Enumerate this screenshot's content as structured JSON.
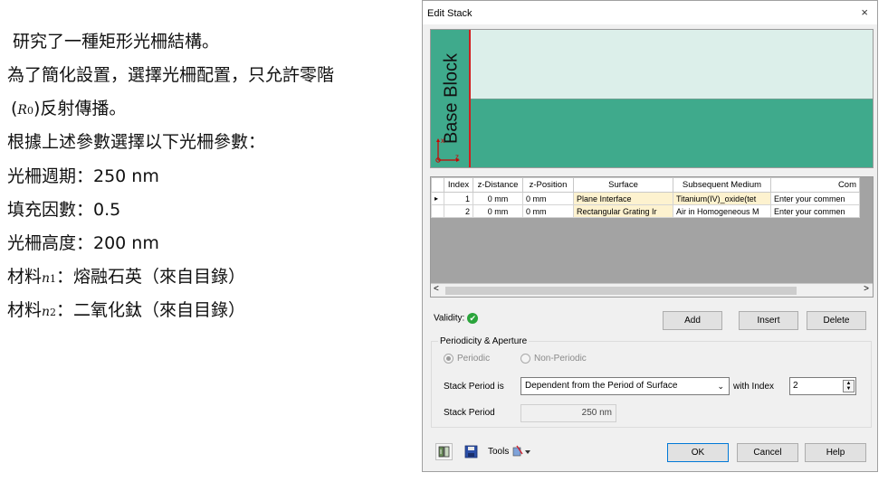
{
  "description": {
    "line1": "研究了一種矩形光柵結構。",
    "line2": "為了簡化設置，選擇光柵配置，只允許零階",
    "line3_pre": "(",
    "line3_sym": "R",
    "line3_sub": "0",
    "line3_post": ")反射傳播。",
    "line4": "根據上述參數選擇以下光柵參數：",
    "line5": "光柵週期：250 nm",
    "line6": "填充因數：0.5",
    "line7": "光柵高度：200 nm",
    "line8_pre": "材料",
    "line8_sym": "n",
    "line8_sub": "1",
    "line8_post": "：熔融石英（來自目錄）",
    "line9_pre": "材料",
    "line9_sym": "n",
    "line9_sub": "2",
    "line9_post": "：二氧化鈦（來自目錄）"
  },
  "dialog": {
    "title": "Edit Stack",
    "close": "×",
    "preview": {
      "base_block_label": "Base Block",
      "axis_x": "x",
      "axis_z": "z",
      "colors": {
        "air": "#dcefea",
        "titanium": "#3faa8c",
        "base": "#3faa8c",
        "marker": "#d21f1f"
      }
    },
    "table": {
      "columns": [
        "Index",
        "z-Distance",
        "z-Position",
        "Surface",
        "Subsequent Medium",
        "Com"
      ],
      "rows": [
        {
          "marker": "▸",
          "index": "1",
          "z_distance": "0 mm",
          "z_position": "0 mm",
          "surface": "Plane Interface",
          "medium": "Titanium(IV)_oxide(tet",
          "comment": "Enter your commen"
        },
        {
          "marker": "",
          "index": "2",
          "z_distance": "0 mm",
          "z_position": "0 mm",
          "surface": "Rectangular Grating Ir",
          "medium": "Air in Homogeneous M",
          "comment": "Enter your commen"
        }
      ],
      "scroll_left": "<",
      "scroll_right": ">"
    },
    "validity_label": "Validity:",
    "validity_icon": "✔",
    "buttons": {
      "add": "Add",
      "insert": "Insert",
      "delete": "Delete",
      "ok": "OK",
      "cancel": "Cancel",
      "help": "Help",
      "tools": "Tools"
    },
    "periodicity": {
      "group_title": "Periodicity & Aperture",
      "periodic": "Periodic",
      "non_periodic": "Non-Periodic",
      "stack_period_is_label": "Stack Period is",
      "stack_period_is_value": "Dependent from the Period of Surface",
      "with_index_label": "with Index",
      "with_index_value": "2",
      "stack_period_label": "Stack Period",
      "stack_period_value": "250 nm"
    }
  }
}
